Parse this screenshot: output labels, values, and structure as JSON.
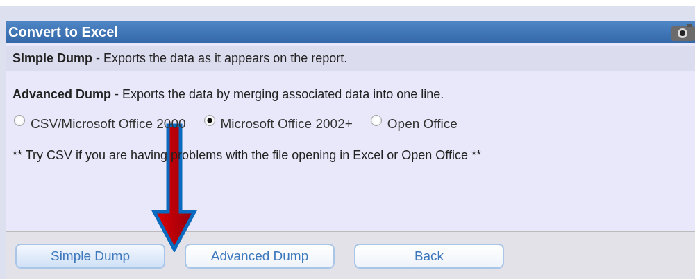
{
  "dialog": {
    "title": "Convert to Excel",
    "options": [
      {
        "text": "**Simple Dump** - Exports the data as it appears on the report.",
        "selected": true
      },
      {
        "text": "**Advanced Dump** - Exports the data by merging associated data into one line.",
        "selected": false
      }
    ],
    "formats": [
      {
        "label": "CSV/Microsoft Office 2000",
        "selected": false
      },
      {
        "label": "Microsoft Office 2002+",
        "selected": true
      },
      {
        "label": "Open Office",
        "selected": false
      }
    ],
    "note": "** Try CSV if you are having problems with the file opening in Excel or Open Office **",
    "buttons": [
      {
        "label": "Simple Dump",
        "highlighted": true
      },
      {
        "label": "Advanced Dump",
        "highlighted": false
      },
      {
        "label": "Back",
        "highlighted": false
      }
    ]
  }
}
